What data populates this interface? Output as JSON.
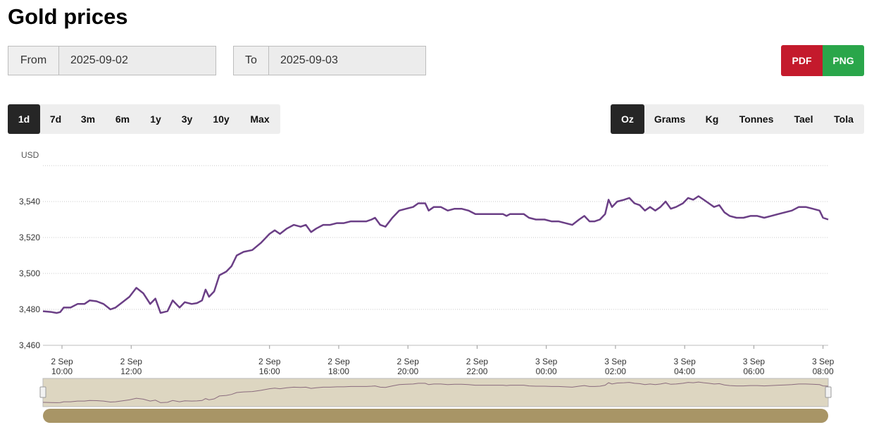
{
  "page": {
    "title": "Gold prices"
  },
  "date_range": {
    "from_label": "From",
    "from_value": "2025-09-02",
    "to_label": "To",
    "to_value": "2025-09-03"
  },
  "export": {
    "pdf_label": "PDF",
    "png_label": "PNG"
  },
  "periods": [
    "1d",
    "7d",
    "3m",
    "6m",
    "1y",
    "3y",
    "10y",
    "Max"
  ],
  "active_period": "1d",
  "units": [
    "Oz",
    "Grams",
    "Kg",
    "Tonnes",
    "Tael",
    "Tola"
  ],
  "active_unit": "Oz",
  "colors": {
    "line": "#6b3f86",
    "navigator_bg": "#ddd6c1",
    "navigator_scroll": "#a89566",
    "pdf": "#c41a2c",
    "png": "#2aa64a"
  },
  "chart_data": {
    "type": "line",
    "ylabel": "USD",
    "ylim": [
      3460,
      3560
    ],
    "y_ticks": [
      3460,
      3480,
      3500,
      3520,
      3540
    ],
    "y_tick_labels": [
      "3,460",
      "3,480",
      "3,500",
      "3,520",
      "3,540"
    ],
    "x_ticks": [
      {
        "h": 10,
        "date": "2 Sep",
        "time": "10:00"
      },
      {
        "h": 12,
        "date": "2 Sep",
        "time": "12:00"
      },
      {
        "h": 16,
        "date": "2 Sep",
        "time": "16:00"
      },
      {
        "h": 18,
        "date": "2 Sep",
        "time": "18:00"
      },
      {
        "h": 20,
        "date": "2 Sep",
        "time": "20:00"
      },
      {
        "h": 22,
        "date": "2 Sep",
        "time": "22:00"
      },
      {
        "h": 24,
        "date": "3 Sep",
        "time": "00:00"
      },
      {
        "h": 26,
        "date": "3 Sep",
        "time": "02:00"
      },
      {
        "h": 28,
        "date": "3 Sep",
        "time": "04:00"
      },
      {
        "h": 30,
        "date": "3 Sep",
        "time": "06:00"
      },
      {
        "h": 32,
        "date": "3 Sep",
        "time": "08:00"
      }
    ],
    "xlim": [
      9.45,
      32.15
    ],
    "series": [
      {
        "points": [
          [
            9.45,
            3479
          ],
          [
            9.7,
            3478.5
          ],
          [
            9.85,
            3478
          ],
          [
            9.95,
            3478.5
          ],
          [
            10.05,
            3481
          ],
          [
            10.25,
            3481
          ],
          [
            10.45,
            3483
          ],
          [
            10.65,
            3483
          ],
          [
            10.8,
            3485
          ],
          [
            11.0,
            3484.5
          ],
          [
            11.2,
            3483
          ],
          [
            11.4,
            3480
          ],
          [
            11.55,
            3481
          ],
          [
            11.75,
            3484
          ],
          [
            11.95,
            3487
          ],
          [
            12.15,
            3492
          ],
          [
            12.35,
            3489
          ],
          [
            12.55,
            3483
          ],
          [
            12.7,
            3486
          ],
          [
            12.85,
            3478
          ],
          [
            13.05,
            3479
          ],
          [
            13.2,
            3485
          ],
          [
            13.4,
            3481
          ],
          [
            13.55,
            3484
          ],
          [
            13.75,
            3483
          ],
          [
            13.9,
            3483.5
          ],
          [
            14.05,
            3485
          ],
          [
            14.15,
            3491
          ],
          [
            14.25,
            3487
          ],
          [
            14.4,
            3490
          ],
          [
            14.55,
            3499
          ],
          [
            14.75,
            3501
          ],
          [
            14.9,
            3504
          ],
          [
            15.05,
            3510
          ],
          [
            15.25,
            3512
          ],
          [
            15.5,
            3513
          ],
          [
            15.75,
            3517
          ],
          [
            16.0,
            3522
          ],
          [
            16.15,
            3524
          ],
          [
            16.3,
            3522
          ],
          [
            16.5,
            3525
          ],
          [
            16.7,
            3527
          ],
          [
            16.9,
            3526
          ],
          [
            17.05,
            3527
          ],
          [
            17.2,
            3523
          ],
          [
            17.35,
            3525
          ],
          [
            17.55,
            3527
          ],
          [
            17.75,
            3527
          ],
          [
            17.95,
            3528
          ],
          [
            18.15,
            3528
          ],
          [
            18.35,
            3529
          ],
          [
            18.55,
            3529
          ],
          [
            18.8,
            3529
          ],
          [
            18.95,
            3530
          ],
          [
            19.05,
            3531
          ],
          [
            19.2,
            3527
          ],
          [
            19.35,
            3526
          ],
          [
            19.55,
            3531
          ],
          [
            19.75,
            3535
          ],
          [
            19.95,
            3536
          ],
          [
            20.15,
            3537
          ],
          [
            20.3,
            3539
          ],
          [
            20.5,
            3539
          ],
          [
            20.6,
            3535
          ],
          [
            20.75,
            3537
          ],
          [
            20.95,
            3537
          ],
          [
            21.15,
            3535
          ],
          [
            21.35,
            3536
          ],
          [
            21.55,
            3536
          ],
          [
            21.75,
            3535
          ],
          [
            21.95,
            3533
          ],
          [
            22.15,
            3533
          ],
          [
            22.35,
            3533
          ],
          [
            22.55,
            3533
          ],
          [
            22.75,
            3533
          ],
          [
            22.85,
            3532
          ],
          [
            22.95,
            3533
          ],
          [
            23.15,
            3533
          ],
          [
            23.35,
            3533
          ],
          [
            23.5,
            3531
          ],
          [
            23.7,
            3530
          ],
          [
            23.95,
            3530
          ],
          [
            24.15,
            3529
          ],
          [
            24.35,
            3529
          ],
          [
            24.55,
            3528
          ],
          [
            24.75,
            3527
          ],
          [
            24.95,
            3530
          ],
          [
            25.1,
            3532
          ],
          [
            25.25,
            3529
          ],
          [
            25.4,
            3529
          ],
          [
            25.55,
            3530
          ],
          [
            25.7,
            3533
          ],
          [
            25.8,
            3541
          ],
          [
            25.9,
            3537
          ],
          [
            26.05,
            3540
          ],
          [
            26.25,
            3541
          ],
          [
            26.4,
            3542
          ],
          [
            26.55,
            3539
          ],
          [
            26.7,
            3538
          ],
          [
            26.85,
            3535
          ],
          [
            27.0,
            3537
          ],
          [
            27.15,
            3535
          ],
          [
            27.3,
            3537
          ],
          [
            27.45,
            3540
          ],
          [
            27.6,
            3536
          ],
          [
            27.75,
            3537
          ],
          [
            27.95,
            3539
          ],
          [
            28.1,
            3542
          ],
          [
            28.25,
            3541
          ],
          [
            28.4,
            3543
          ],
          [
            28.55,
            3541
          ],
          [
            28.7,
            3539
          ],
          [
            28.85,
            3537
          ],
          [
            29.0,
            3538
          ],
          [
            29.15,
            3534
          ],
          [
            29.3,
            3532
          ],
          [
            29.5,
            3531
          ],
          [
            29.7,
            3531
          ],
          [
            29.9,
            3532
          ],
          [
            30.1,
            3532
          ],
          [
            30.3,
            3531
          ],
          [
            30.5,
            3532
          ],
          [
            30.7,
            3533
          ],
          [
            30.9,
            3534
          ],
          [
            31.1,
            3535
          ],
          [
            31.3,
            3537
          ],
          [
            31.5,
            3537
          ],
          [
            31.7,
            3536
          ],
          [
            31.9,
            3535
          ],
          [
            32.0,
            3531
          ],
          [
            32.15,
            3530
          ]
        ]
      }
    ]
  }
}
